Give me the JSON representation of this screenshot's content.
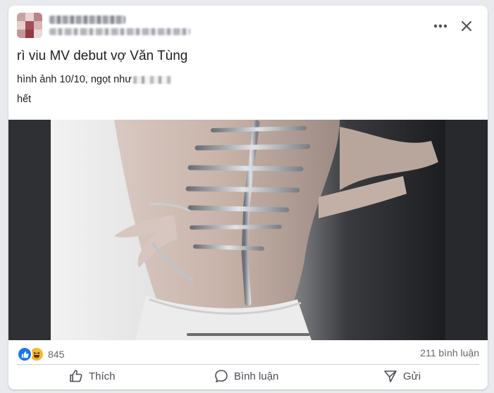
{
  "post": {
    "title": "rì viu MV debut vợ Văn Tùng",
    "body_line1": "hình ảnh 10/10, ngọt như",
    "body_line2": "hết"
  },
  "header": {
    "more_icon": "more-horizontal-icon",
    "close_icon": "close-icon"
  },
  "stats": {
    "reaction_count": "845",
    "comment_count": "211 bình luận",
    "reaction_icons": [
      "like-reaction-icon",
      "haha-reaction-icon"
    ]
  },
  "actions": {
    "like_label": "Thích",
    "comment_label": "Bình luận",
    "share_label": "Gửi"
  },
  "colors": {
    "like_blue": "#1877f2",
    "haha_yellow": "#f7b928",
    "secondary_text": "#65676b"
  }
}
